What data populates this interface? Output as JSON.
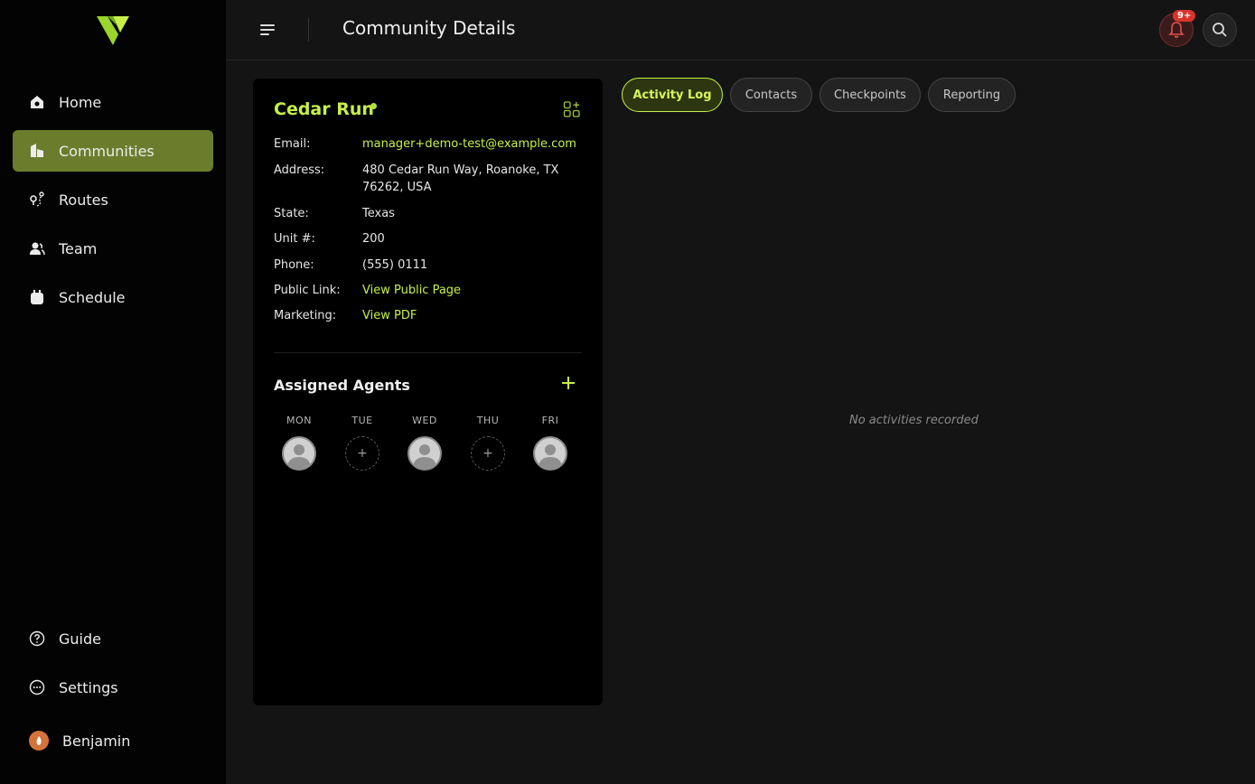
{
  "header": {
    "title": "Community Details",
    "notification_badge": "9+"
  },
  "sidebar": {
    "items": [
      {
        "label": "Home",
        "icon": "home-icon"
      },
      {
        "label": "Communities",
        "icon": "building-icon",
        "active": true
      },
      {
        "label": "Routes",
        "icon": "route-icon"
      },
      {
        "label": "Team",
        "icon": "team-icon"
      },
      {
        "label": "Schedule",
        "icon": "calendar-icon"
      }
    ],
    "bottom_items": [
      {
        "label": "Guide",
        "icon": "help-icon"
      },
      {
        "label": "Settings",
        "icon": "settings-icon"
      }
    ],
    "user": {
      "name": "Benjamin"
    }
  },
  "community": {
    "name": "Cedar Run",
    "fields": [
      {
        "label": "Email:",
        "value": "manager+demo-test@example.com",
        "link": true
      },
      {
        "label": "Address:",
        "value": "480 Cedar Run Way, Roanoke, TX 76262, USA",
        "link": false
      },
      {
        "label": "State:",
        "value": "Texas",
        "link": false
      },
      {
        "label": "Unit #:",
        "value": "200",
        "link": false
      },
      {
        "label": "Phone:",
        "value": "(555) 0111",
        "link": false
      },
      {
        "label": "Public Link:",
        "value": "View Public Page",
        "link": true
      },
      {
        "label": "Marketing:",
        "value": "View PDF",
        "link": true
      }
    ]
  },
  "agents": {
    "title": "Assigned Agents",
    "days": [
      {
        "label": "MON",
        "assigned": true
      },
      {
        "label": "TUE",
        "assigned": false
      },
      {
        "label": "WED",
        "assigned": true
      },
      {
        "label": "THU",
        "assigned": false
      },
      {
        "label": "FRI",
        "assigned": true
      }
    ],
    "empty_slot_symbol": "+"
  },
  "tabs": [
    {
      "label": "Activity Log",
      "active": true
    },
    {
      "label": "Contacts",
      "active": false
    },
    {
      "label": "Checkpoints",
      "active": false
    },
    {
      "label": "Reporting",
      "active": false
    }
  ],
  "activity": {
    "empty_message": "No activities recorded"
  },
  "colors": {
    "accent": "#c7ef4a",
    "active_nav": "#6b7d2c",
    "badge": "#d9342b"
  }
}
